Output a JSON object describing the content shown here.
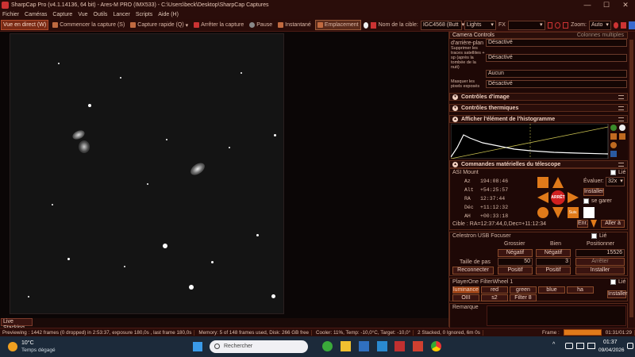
{
  "window": {
    "title": "SharpCap Pro (v4.1.14136, 64 bit) - Ares-M PRO (IMX533) - C:\\Users\\beck\\Desktop\\SharpCap Captures",
    "controls": [
      "—",
      "☐",
      "✕"
    ]
  },
  "menu": [
    "Fichier",
    "Caméras",
    "Capture",
    "Vue",
    "Outils",
    "Lancer",
    "Scripts",
    "Aide (H)"
  ],
  "toolbar": {
    "live": "Vue en direct (W)",
    "start": "Commencer la capture (S)",
    "quick": "Capture rapide (Q)",
    "stop": "Arrêter la capture",
    "pause": "Pause",
    "snapshot": "Instantané",
    "placement": "Emplacement",
    "target_label": "Nom de la cible:",
    "target_value": "IGC4568 (Butt",
    "frame_type": "Lights",
    "fx": "FX",
    "zoom_label": "Zoom:",
    "zoom_value": "Auto"
  },
  "viewer": {
    "live_stacking": "Live Stacking"
  },
  "panel": {
    "camera_controls": "Camera Controls",
    "multi_columns": "Colonnes multiples",
    "rows": [
      {
        "label": "d'arrière-plan",
        "value": "Désactivé"
      },
      {
        "label": "Supprimer les traces satellites + sp (après la tombée de la nuit)",
        "value": "Désactivé"
      },
      {
        "label": "",
        "value": "Aucun"
      },
      {
        "label": "Masquer les pixels exposés",
        "value": "Désactivé"
      }
    ],
    "image_controls": "Contrôles d'image",
    "thermal_controls": "Contrôles thermiques",
    "histogram": "Afficher l'élément de l'histogramme",
    "telescope": "Commandes matérielles du télescope",
    "mount": {
      "name": "ASI Mount",
      "linked": "Lié",
      "evaluer": "Évaluer:",
      "rate": "32x",
      "install": "Installer",
      "park": "se garer",
      "stop": "ARRÊT",
      "follow": "Suiv.",
      "az": "Az",
      "az_v": "194:08:46",
      "alt": "Alt",
      "alt_v": "+54:25:57",
      "ra": "RA",
      "ra_v": "12:37:44",
      "dec": "Déc",
      "dec_v": "+11:12:32",
      "ah": "AH",
      "ah_v": "+00:33:18",
      "target": "Cible : RA=12:37:44,0,Dec=+11:12:34",
      "goto_btn": "Enr.",
      "goto2": "Aller à"
    },
    "focuser": {
      "name": "Celestron USB Focuser",
      "linked": "Lié",
      "coarse": "Grossier",
      "fine": "Bien",
      "position": "Positionner",
      "neg": "Négatif",
      "pos": "Positif",
      "pos_value": "15526",
      "step_label": "Taille de pas",
      "coarse_step": "50",
      "fine_step": "3",
      "stop": "Arrêter",
      "reconnect": "Reconnecter",
      "install": "Installer"
    },
    "filter": {
      "name": "PlayerOne FilterWheel 1",
      "linked": "Lié",
      "filters": [
        "luminance",
        "red",
        "green",
        "blue",
        "ha",
        "OIII",
        "s2",
        "Filter 8"
      ],
      "install": "Installer"
    },
    "remarks": "Remarque"
  },
  "status": [
    "Previewing : 1442 frames (0 dropped) in 2:53:37, exposure 180,0s , last frame 180,0s",
    "Memory: 5 of 148 frames used, Disk: 266 GB free",
    "Cooler: 11%, Temp: -10,0°C, Target: -10,0°",
    "2 Stacked, 0 Ignored, 6m 0s",
    "Frame :",
    "01:31/01:29"
  ],
  "taskbar": {
    "weather_temp": "10°C",
    "weather_desc": "Temps dégagé",
    "search": "Rechercher",
    "time": "01:37",
    "date": "09/04/2026"
  }
}
